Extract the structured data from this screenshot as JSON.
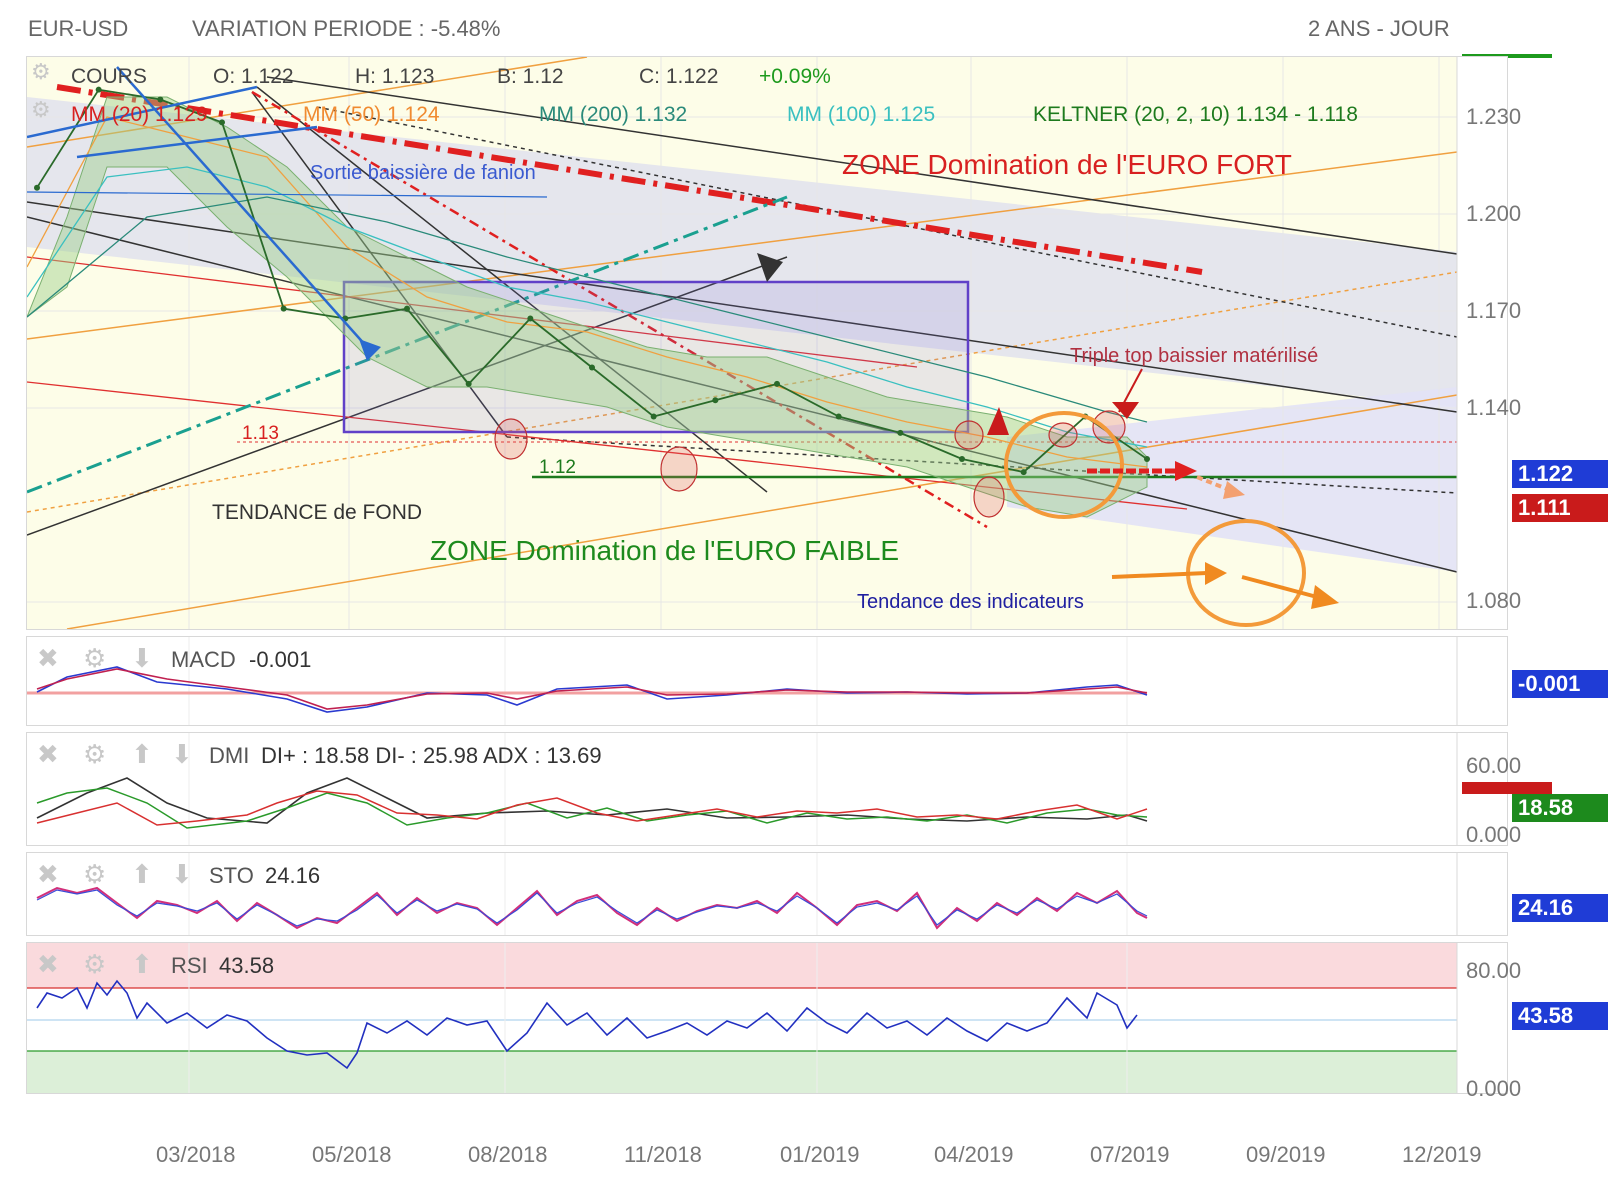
{
  "header": {
    "symbol": "EUR-USD",
    "variation": "VARIATION PERIODE : -5.48%",
    "period": "2 ANS - JOUR"
  },
  "legend": {
    "cours": "COURS",
    "open": "O: 1.122",
    "high": "H: 1.123",
    "low": "B: 1.12",
    "close": "C: 1.122",
    "change": "+0.09%",
    "mm20": "MM (20) 1.129",
    "mm50": "MM (50) 1.124",
    "mm200": "MM (200) 1.132",
    "mm100": "MM (100) 1.125",
    "keltner": "KELTNER (20, 2, 10) 1.134 - 1.118"
  },
  "annotations": {
    "zone_fort": "ZONE Domination de l'EURO FORT",
    "zone_faible": "ZONE Domination de l'EURO FAIBLE",
    "sortie": "Sortie baissière de fanion",
    "triple_top": "Triple top baissier matérilisé",
    "tendance_fond": "TENDANCE de FOND",
    "tendance_ind": "Tendance des indicateurs",
    "lvl_113": "1.13",
    "lvl_112": "1.12"
  },
  "price_axis": {
    "ticks": [
      "1.230",
      "1.200",
      "1.170",
      "1.140",
      "1.080"
    ],
    "last_price": "1.122",
    "support_price": "1.111"
  },
  "indicators": {
    "macd": {
      "name": "MACD",
      "value": "-0.001",
      "box": "-0.001"
    },
    "dmi": {
      "name": "DMI",
      "value": "DI+ : 18.58 DI- : 25.98 ADX : 13.69",
      "box": "18.58",
      "ticks": [
        "60.00",
        "0.000"
      ]
    },
    "sto": {
      "name": "STO",
      "value": "24.16",
      "box": "24.16"
    },
    "rsi": {
      "name": "RSI",
      "value": "43.58",
      "box": "43.58",
      "ticks": [
        "80.00",
        "0.000"
      ]
    }
  },
  "x_axis": {
    "labels": [
      "03/2018",
      "05/2018",
      "08/2018",
      "11/2018",
      "01/2019",
      "04/2019",
      "07/2019",
      "09/2019",
      "12/2019"
    ]
  },
  "colors": {
    "last_price_box": "#1f3cd6",
    "support_box": "#c91b1b",
    "positive": "#1d9a1d",
    "rsi_line": "#2230c0",
    "sto_line": "#d22f7a"
  },
  "chart_data": {
    "type": "line",
    "title": "EUR-USD",
    "ylim": [
      1.07,
      1.245
    ],
    "x": [
      "2018-01",
      "2018-02",
      "2018-03",
      "2018-04",
      "2018-05",
      "2018-06",
      "2018-07",
      "2018-08",
      "2018-09",
      "2018-10",
      "2018-11",
      "2018-12",
      "2019-01",
      "2019-02",
      "2019-03",
      "2019-04",
      "2019-05",
      "2019-06",
      "2019-07"
    ],
    "series": [
      {
        "name": "COURS",
        "values": [
          1.205,
          1.235,
          1.232,
          1.225,
          1.168,
          1.165,
          1.168,
          1.145,
          1.165,
          1.15,
          1.135,
          1.14,
          1.145,
          1.135,
          1.13,
          1.122,
          1.118,
          1.135,
          1.122
        ]
      }
    ]
  }
}
